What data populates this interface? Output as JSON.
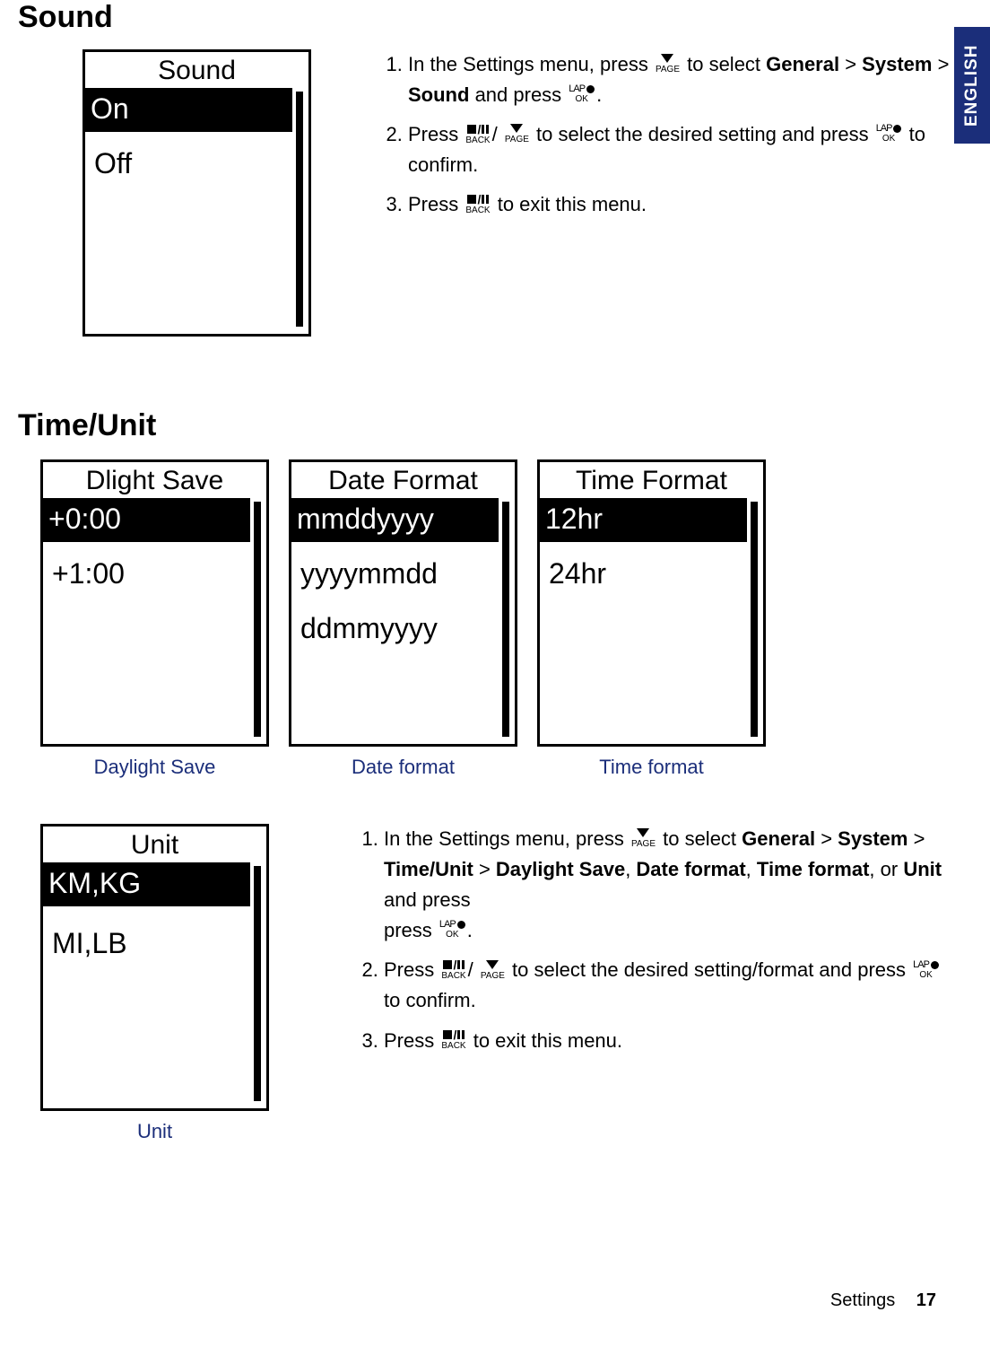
{
  "lang_tab": "ENGLISH",
  "sections": {
    "sound_heading": "Sound",
    "timeunit_heading": "Time/Unit"
  },
  "sound_screen": {
    "title": "Sound",
    "options": {
      "o1": "On",
      "o2": "Off"
    }
  },
  "sound_steps": {
    "s1a": "In the Settings menu, press ",
    "s1b": " to select ",
    "s1c_bold1": "General",
    "gt": " > ",
    "s1c_bold2": "System",
    "s1c_bold3": "Sound",
    "s1d": " and press ",
    "period": ".",
    "s2a": "Press ",
    "slash": "/",
    "s2b": " to select the desired setting and press ",
    "s2c": " to confirm.",
    "s3a": "Press ",
    "s3b": " to exit this menu."
  },
  "dlight": {
    "title": "Dlight Save",
    "o1": "+0:00",
    "o2": "+1:00",
    "caption": "Daylight Save"
  },
  "datefmt": {
    "title": "Date Format",
    "o1": "mmddyyyy",
    "o2": "yyyymmdd",
    "o3": "ddmmyyyy",
    "caption": "Date format"
  },
  "timefmt": {
    "title": "Time Format",
    "o1": "12hr",
    "o2": "24hr",
    "caption": "Time format"
  },
  "unit": {
    "title": "Unit",
    "o1": "KM,KG",
    "o2": "MI,LB",
    "caption": "Unit"
  },
  "time_steps": {
    "s1a": "In the Settings menu, press ",
    "s1b": " to select ",
    "b1": "General",
    "gt": " > ",
    "b2": "System",
    "b3": "Time/Unit",
    "b4": "Daylight Save",
    "comma": ", ",
    "b5": "Date format",
    "b6": "Time format",
    "or": ", or ",
    "b7": "Unit",
    "and": " and press ",
    "period": ".",
    "s2a": "Press ",
    "slash": "/",
    "s2b": " to select the desired setting/format and press ",
    "s2c": " to confirm.",
    "s3a": "Press ",
    "s3b": " to exit this menu."
  },
  "button_labels": {
    "page": "PAGE",
    "back": "BACK",
    "lap": "LAP",
    "ok": "OK"
  },
  "footer": {
    "section": "Settings",
    "page": "17"
  }
}
